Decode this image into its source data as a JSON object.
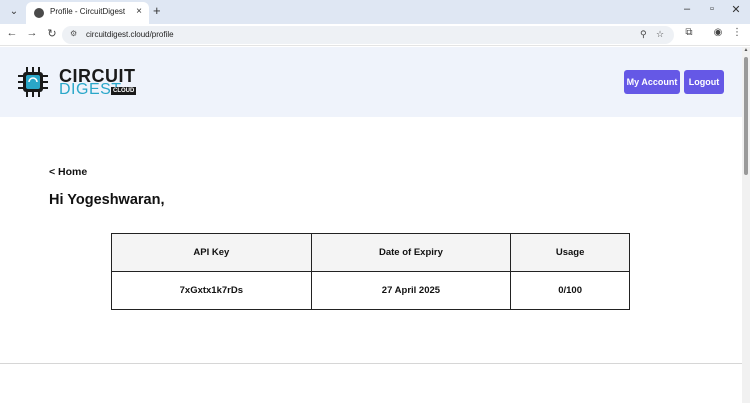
{
  "browser": {
    "tab_title": "Profile - CircuitDigest",
    "tab_close": "×",
    "new_tab": "+",
    "tab_menu": "⌄",
    "window_controls": {
      "minimize": "–",
      "maximize": "▫",
      "close": "✕"
    },
    "nav": {
      "back": "←",
      "forward": "→",
      "reload": "↻"
    },
    "url": "circuitdigest.cloud/profile",
    "site_info": "⚙",
    "zoom": "⚲",
    "bookmark": "☆",
    "extensions": "⧉",
    "profile": "◉",
    "menu": "⋮"
  },
  "header": {
    "logo": {
      "line1": "CIRCUIT",
      "line2": "DIGEST",
      "badge": "CLOUD"
    },
    "my_account_label": "My Account",
    "logout_label": "Logout",
    "accent_color": "#6558e6"
  },
  "main": {
    "home_link": "< Home",
    "greeting": "Hi Yogeshwaran,",
    "table": {
      "headers": [
        "API Key",
        "Date of Expiry",
        "Usage"
      ],
      "rows": [
        [
          "7xGxtx1k7rDs",
          "27 April 2025",
          "0/100"
        ]
      ]
    }
  }
}
